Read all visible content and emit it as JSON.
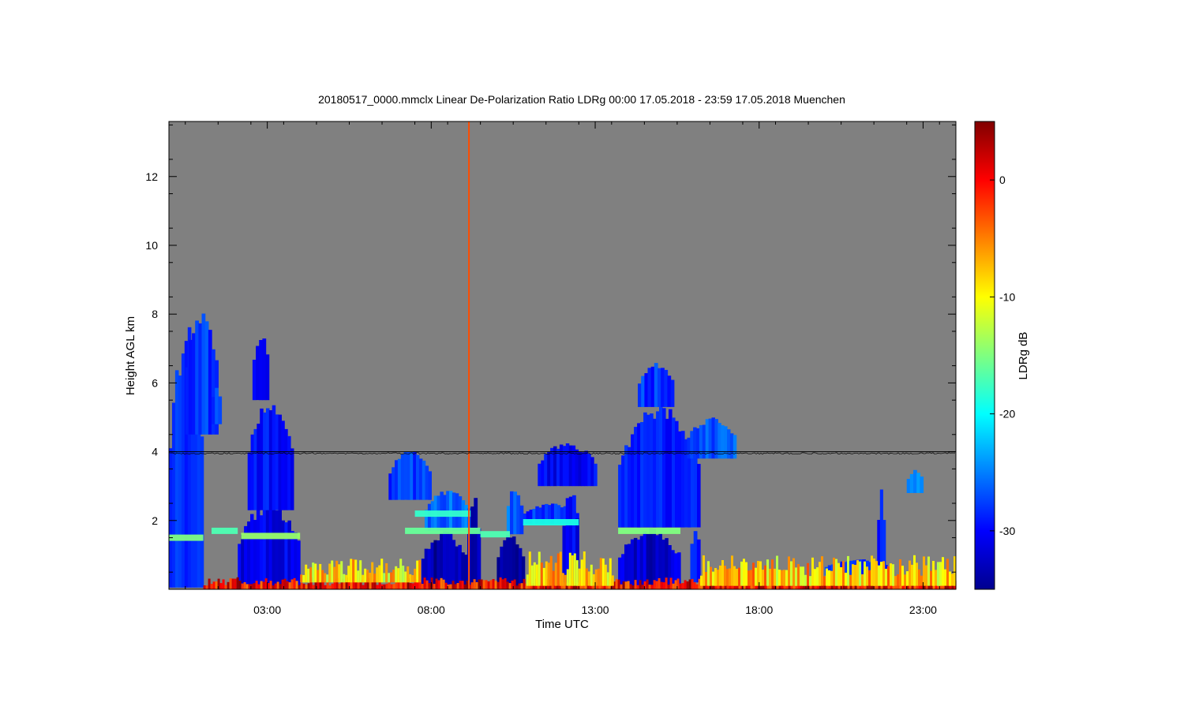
{
  "chart_data": {
    "type": "heatmap",
    "title": "20180517_0000.mmclx Linear De-Polarization Ratio LDRg   00:00 17.05.2018 - 23:59 17.05.2018 Muenchen",
    "xlabel": "Time UTC",
    "ylabel": "Height AGL km",
    "colorbar_label": "LDRg dB",
    "xlim": [
      0,
      24
    ],
    "ylim": [
      0,
      13.6
    ],
    "clim": [
      -35,
      5
    ],
    "x_ticks": [
      {
        "value": 3,
        "label": "03:00"
      },
      {
        "value": 8,
        "label": "08:00"
      },
      {
        "value": 13,
        "label": "13:00"
      },
      {
        "value": 18,
        "label": "18:00"
      },
      {
        "value": 23,
        "label": "23:00"
      }
    ],
    "y_ticks": [
      {
        "value": 2,
        "label": "2"
      },
      {
        "value": 4,
        "label": "4"
      },
      {
        "value": 6,
        "label": "6"
      },
      {
        "value": 8,
        "label": "8"
      },
      {
        "value": 10,
        "label": "10"
      },
      {
        "value": 12,
        "label": "12"
      }
    ],
    "c_ticks": [
      {
        "value": 0,
        "label": "0"
      },
      {
        "value": -10,
        "label": "-10"
      },
      {
        "value": -20,
        "label": "-20"
      },
      {
        "value": -30,
        "label": "-30"
      }
    ],
    "colormap": "jet",
    "background_color": "#808080",
    "reference_line_km": 4.0,
    "cloud_regions": [
      {
        "t0": 0.0,
        "t1": 1.05,
        "h0": 0.05,
        "h1": 7.8,
        "ldr": -29
      },
      {
        "t0": 0.5,
        "t1": 1.5,
        "h0": 4.5,
        "h1": 8.2,
        "ldr": -28
      },
      {
        "t0": 1.3,
        "t1": 1.6,
        "h0": 4.8,
        "h1": 6.0,
        "ldr": -27
      },
      {
        "t0": 2.1,
        "t1": 4.0,
        "h0": 0.05,
        "h1": 2.6,
        "ldr": -31
      },
      {
        "t0": 2.4,
        "t1": 3.8,
        "h0": 2.3,
        "h1": 5.6,
        "ldr": -30
      },
      {
        "t0": 2.55,
        "t1": 3.05,
        "h0": 5.5,
        "h1": 7.5,
        "ldr": -29
      },
      {
        "t0": 6.7,
        "t1": 8.0,
        "h0": 2.6,
        "h1": 4.1,
        "ldr": -28
      },
      {
        "t0": 7.8,
        "t1": 9.2,
        "h0": 1.7,
        "h1": 2.9,
        "ldr": -26
      },
      {
        "t0": 7.7,
        "t1": 9.1,
        "h0": 0.05,
        "h1": 1.7,
        "ldr": -33
      },
      {
        "t0": 9.1,
        "t1": 9.5,
        "h0": 0.05,
        "h1": 2.8,
        "ldr": -32
      },
      {
        "t0": 10.0,
        "t1": 10.85,
        "h0": 0.05,
        "h1": 1.7,
        "ldr": -33
      },
      {
        "t0": 10.3,
        "t1": 10.8,
        "h0": 1.6,
        "h1": 3.0,
        "ldr": -26
      },
      {
        "t0": 11.25,
        "t1": 13.05,
        "h0": 3.0,
        "h1": 4.3,
        "ldr": -30
      },
      {
        "t0": 10.8,
        "t1": 12.5,
        "h0": 1.9,
        "h1": 2.5,
        "ldr": -28
      },
      {
        "t0": 12.0,
        "t1": 12.5,
        "h0": 0.2,
        "h1": 3.0,
        "ldr": -30
      },
      {
        "t0": 13.7,
        "t1": 15.6,
        "h0": 0.05,
        "h1": 1.8,
        "ldr": -32
      },
      {
        "t0": 13.7,
        "t1": 16.2,
        "h0": 1.8,
        "h1": 5.5,
        "ldr": -29
      },
      {
        "t0": 14.3,
        "t1": 15.4,
        "h0": 5.3,
        "h1": 6.6,
        "ldr": -28
      },
      {
        "t0": 15.8,
        "t1": 17.3,
        "h0": 3.8,
        "h1": 5.0,
        "ldr": -27
      },
      {
        "t0": 15.9,
        "t1": 16.2,
        "h0": 0.2,
        "h1": 1.9,
        "ldr": -30
      },
      {
        "t0": 20.0,
        "t1": 22.0,
        "h0": 0.4,
        "h1": 0.9,
        "ldr": -28
      },
      {
        "t0": 21.6,
        "t1": 21.85,
        "h0": 0.1,
        "h1": 3.0,
        "ldr": -30
      },
      {
        "t0": 22.5,
        "t1": 23.0,
        "h0": 2.8,
        "h1": 3.5,
        "ldr": -24
      }
    ],
    "melting_layers": [
      {
        "t0": 0.0,
        "t1": 1.05,
        "h": 1.5,
        "ldr": -15
      },
      {
        "t0": 1.3,
        "t1": 2.1,
        "h": 1.7,
        "ldr": -17
      },
      {
        "t0": 2.2,
        "t1": 4.0,
        "h": 1.55,
        "ldr": -14
      },
      {
        "t0": 7.2,
        "t1": 9.5,
        "h": 1.7,
        "ldr": -16
      },
      {
        "t0": 7.5,
        "t1": 9.2,
        "h": 2.2,
        "ldr": -18
      },
      {
        "t0": 9.5,
        "t1": 10.4,
        "h": 1.6,
        "ldr": -17
      },
      {
        "t0": 10.8,
        "t1": 12.5,
        "h": 1.95,
        "ldr": -19
      },
      {
        "t0": 13.7,
        "t1": 15.6,
        "h": 1.7,
        "ldr": -15
      }
    ],
    "clutter_regions": [
      {
        "t0": 1.05,
        "t1": 24.0,
        "h0": 0.0,
        "h1": 0.35,
        "ldr": 0
      },
      {
        "t0": 4.0,
        "t1": 7.7,
        "h0": 0.2,
        "h1": 0.9,
        "ldr": -9
      },
      {
        "t0": 10.9,
        "t1": 13.6,
        "h0": 0.1,
        "h1": 1.1,
        "ldr": -8
      },
      {
        "t0": 16.2,
        "t1": 24.0,
        "h0": 0.1,
        "h1": 1.0,
        "ldr": -8
      }
    ],
    "spike": {
      "t": 9.15,
      "ldr": -3
    }
  }
}
